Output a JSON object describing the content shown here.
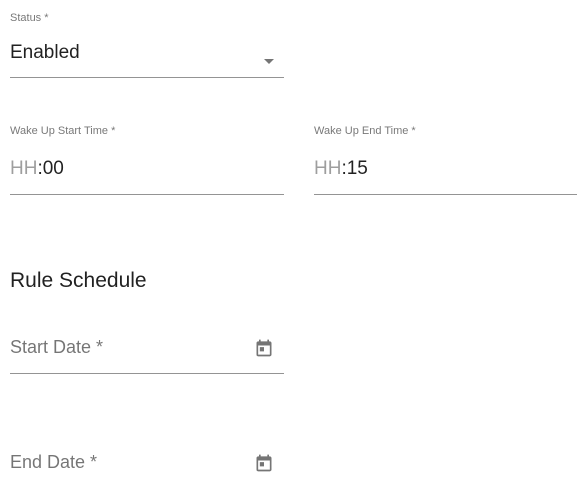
{
  "status": {
    "label": "Status *",
    "value": "Enabled",
    "icon": "arrow-drop-down-icon"
  },
  "wake_start": {
    "label": "Wake Up Start Time *",
    "hours_placeholder": "HH",
    "separator": ":",
    "minutes": "00"
  },
  "wake_end": {
    "label": "Wake Up End Time *",
    "hours_placeholder": "HH",
    "separator": ":",
    "minutes": "15"
  },
  "rule_schedule": {
    "title": "Rule Schedule",
    "start_date_placeholder": "Start Date *",
    "end_date_placeholder": "End Date *",
    "calendar_icon": "calendar-icon"
  }
}
